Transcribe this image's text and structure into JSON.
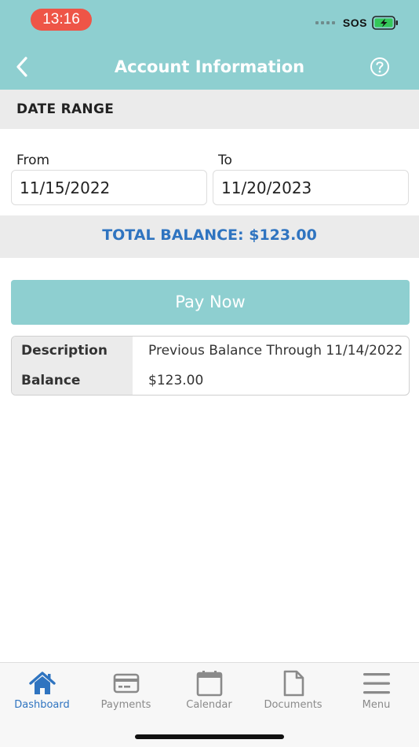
{
  "status_bar": {
    "time": "13:16",
    "carrier": "SOS"
  },
  "header": {
    "title": "Account Information"
  },
  "date_range": {
    "section_label": "DATE RANGE",
    "from_label": "From",
    "from_value": "11/15/2022",
    "to_label": "To",
    "to_value": "11/20/2023"
  },
  "balance": {
    "total_text": "TOTAL BALANCE: $123.00"
  },
  "pay_button": {
    "label": "Pay Now"
  },
  "details": {
    "rows": [
      {
        "key": "Description",
        "value": "Previous Balance Through 11/14/2022"
      },
      {
        "key": "Balance",
        "value": "$123.00"
      }
    ]
  },
  "tabbar": {
    "items": [
      {
        "label": "Dashboard",
        "icon": "home-icon",
        "active": true
      },
      {
        "label": "Payments",
        "icon": "credit-card-icon",
        "active": false
      },
      {
        "label": "Calendar",
        "icon": "calendar-icon",
        "active": false
      },
      {
        "label": "Documents",
        "icon": "document-icon",
        "active": false
      },
      {
        "label": "Menu",
        "icon": "hamburger-menu-icon",
        "active": false
      }
    ]
  },
  "colors": {
    "header": "#8ecfd0",
    "accent": "#2f74c0",
    "status_pill": "#ee5547",
    "battery": "#34c759"
  }
}
